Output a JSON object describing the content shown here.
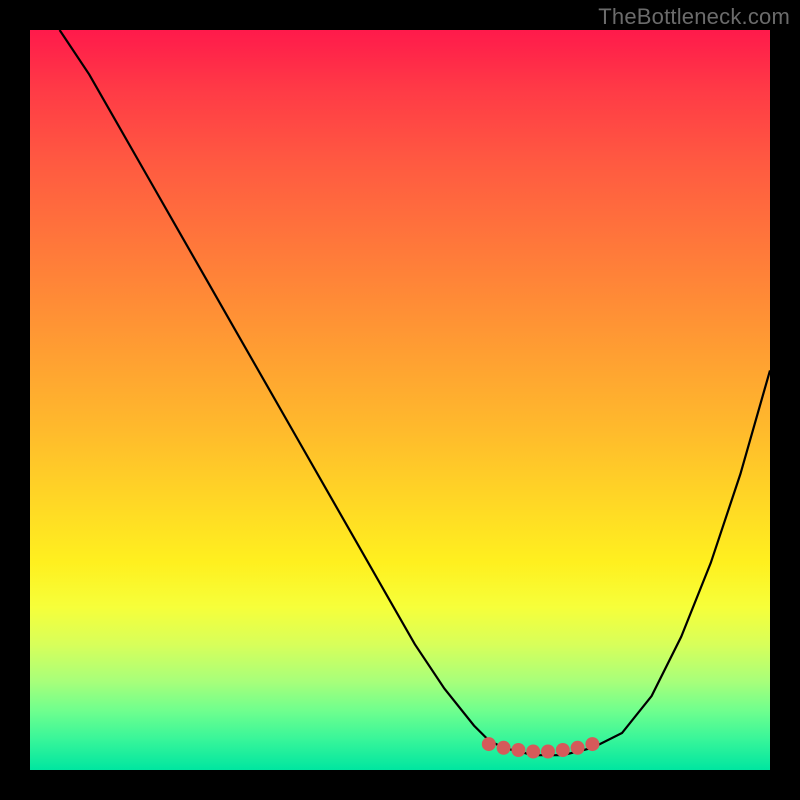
{
  "watermark": "TheBottleneck.com",
  "colors": {
    "frame": "#000000",
    "curve": "#000000",
    "marker_fill": "#d55a5a",
    "marker_stroke": "#c04848"
  },
  "chart_data": {
    "type": "line",
    "title": "",
    "xlabel": "",
    "ylabel": "",
    "xlim": [
      0,
      100
    ],
    "ylim": [
      0,
      100
    ],
    "series": [
      {
        "name": "bottleneck_curve",
        "x": [
          4,
          8,
          12,
          16,
          20,
          24,
          28,
          32,
          36,
          40,
          44,
          48,
          52,
          56,
          60,
          62,
          64,
          68,
          72,
          76,
          80,
          84,
          88,
          92,
          96,
          100
        ],
        "y": [
          100,
          94,
          87,
          80,
          73,
          66,
          59,
          52,
          45,
          38,
          31,
          24,
          17,
          11,
          6,
          4,
          3,
          2,
          2,
          3,
          5,
          10,
          18,
          28,
          40,
          54
        ]
      }
    ],
    "markers": {
      "name": "optimum_range",
      "x": [
        62,
        64,
        66,
        68,
        70,
        72,
        74,
        76
      ],
      "y": [
        3.5,
        3.0,
        2.7,
        2.5,
        2.5,
        2.7,
        3.0,
        3.5
      ]
    }
  }
}
